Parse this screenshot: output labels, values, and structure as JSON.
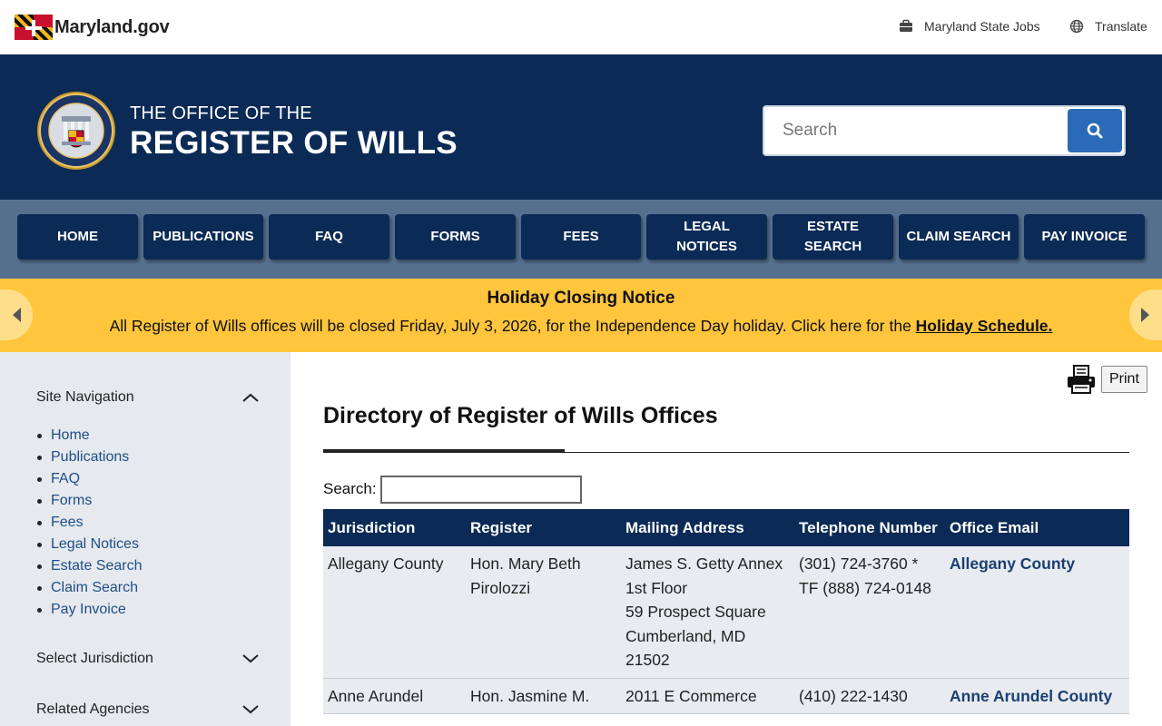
{
  "topbar": {
    "logo_text": "Maryland.gov",
    "jobs_label": "Maryland State Jobs",
    "translate_label": "Translate"
  },
  "header": {
    "title_small": "THE OFFICE OF THE",
    "title_big": "REGISTER OF WILLS",
    "search_placeholder": "Search"
  },
  "nav": {
    "items": [
      {
        "label": "HOME"
      },
      {
        "label": "PUBLICATIONS"
      },
      {
        "label": "FAQ"
      },
      {
        "label": "FORMS"
      },
      {
        "label": "FEES"
      },
      {
        "label": "LEGAL NOTICES"
      },
      {
        "label": "ESTATE SEARCH"
      },
      {
        "label": "CLAIM SEARCH"
      },
      {
        "label": "PAY INVOICE"
      }
    ]
  },
  "alert": {
    "title": "Holiday Closing Notice",
    "text": "All Register of Wills offices will be closed Friday, July 3, 2026, for the Independence Day holiday. Click here for the ",
    "link": "Holiday Schedule."
  },
  "sidebar": {
    "site_nav_label": "Site Navigation",
    "items": [
      "Home",
      "Publications",
      "FAQ",
      "Forms",
      "Fees",
      "Legal Notices",
      "Estate Search",
      "Claim Search",
      "Pay Invoice"
    ],
    "jurisdiction_label": "Select Jurisdiction",
    "agencies_label": "Related Agencies"
  },
  "main": {
    "print_label": "Print",
    "title": "Directory of Register of Wills Offices",
    "search_label": "Search:",
    "search_value": ""
  },
  "table": {
    "headers": [
      "Jurisdiction",
      "Register",
      "Mailing Address",
      "Telephone Number",
      "Office Email"
    ],
    "rows": [
      {
        "jurisdiction": "Allegany County",
        "register": "Hon. Mary Beth Pirolozzi",
        "address": [
          "James S. Getty Annex",
          "1st Floor",
          "59 Prospect Square",
          "Cumberland, MD 21502"
        ],
        "phone": "(301) 724-3760 * TF (888) 724-0148",
        "email": "Allegany County"
      },
      {
        "jurisdiction": "Anne Arundel",
        "register": "Hon. Jasmine M.",
        "address": [
          "2011 E Commerce"
        ],
        "phone": "(410) 222-1430",
        "email": "Anne Arundel County"
      }
    ]
  }
}
